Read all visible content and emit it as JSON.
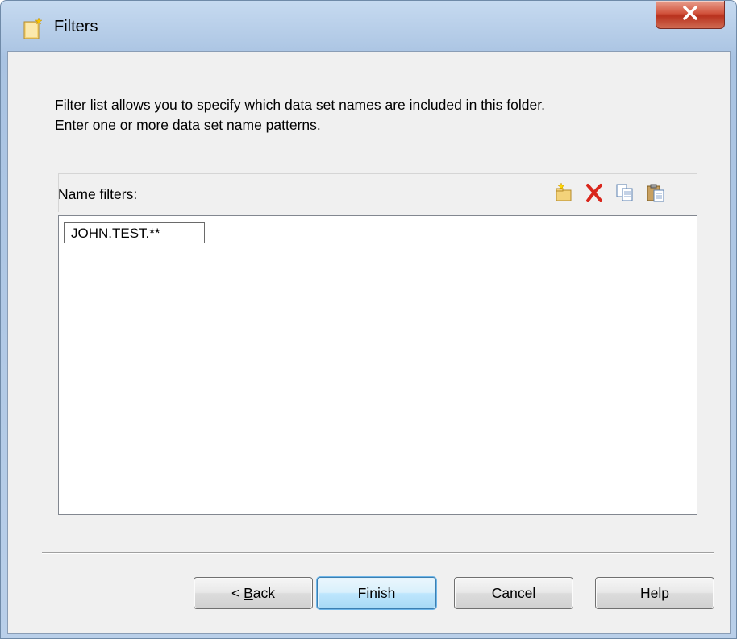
{
  "window": {
    "title": "Filters",
    "close_label": "X"
  },
  "description": {
    "line1": "Filter list allows you to specify which data set names are included in this folder.",
    "line2": "Enter one or more data set name patterns."
  },
  "filters": {
    "label": "Name filters:",
    "items": [
      "JOHN.TEST.**"
    ],
    "toolbar": {
      "add_icon": "new-filter-icon",
      "delete_icon": "delete-icon",
      "copy_icon": "copy-icon",
      "paste_icon": "paste-icon"
    }
  },
  "buttons": {
    "back_prefix": "< ",
    "back_mnemonic": "B",
    "back_rest": "ack",
    "finish": "Finish",
    "cancel": "Cancel",
    "help": "Help"
  },
  "colors": {
    "close_red": "#c84a33",
    "delete_red": "#d9261c",
    "default_button_blue": "#3c7fb1"
  }
}
